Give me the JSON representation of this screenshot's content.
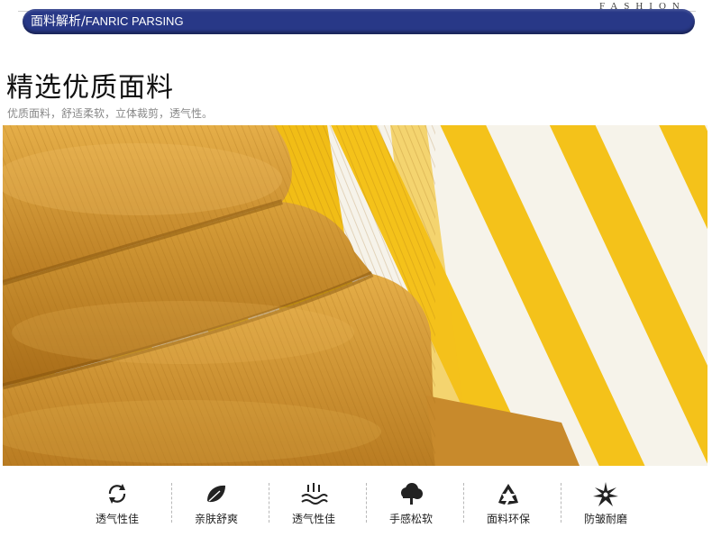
{
  "header": {
    "fashion_label": "FASHION",
    "banner_cn": "面料解析/",
    "banner_en": "FANRIC PARSING"
  },
  "section": {
    "title": "精选优质面料",
    "subtitle": "优质面料，舒适柔软，立体裁剪，透气性。"
  },
  "colors": {
    "banner": "#283887",
    "fabric_mustard": "#d39a36",
    "stripe_yellow": "#f4c21a",
    "stripe_white": "#f6f3ea"
  },
  "features": [
    {
      "icon": "breathable-arrows-icon",
      "label": "透气性佳"
    },
    {
      "icon": "leaf-icon",
      "label": "亲肤舒爽"
    },
    {
      "icon": "heat-waves-icon",
      "label": "透气性佳"
    },
    {
      "icon": "cloud-tree-icon",
      "label": "手感松软"
    },
    {
      "icon": "recycle-icon",
      "label": "面料环保"
    },
    {
      "icon": "star-burst-icon",
      "label": "防皱耐磨"
    }
  ]
}
